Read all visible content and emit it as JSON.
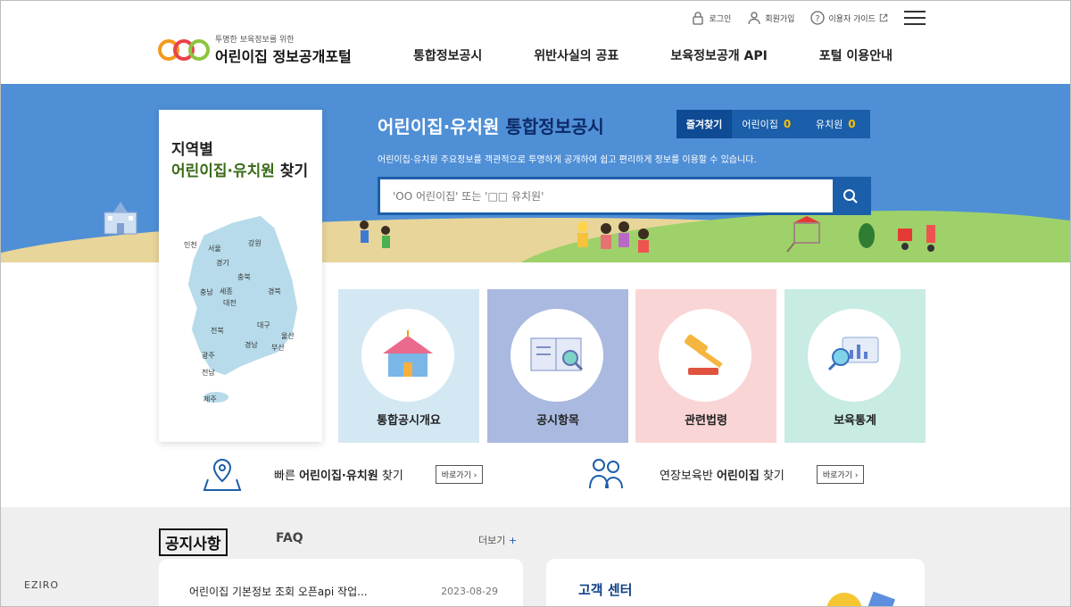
{
  "util": {
    "login": "로그인",
    "signup": "회원가입",
    "guide": "이용자 가이드"
  },
  "logo": {
    "sub": "투명한 보육정보를 위한",
    "main": "어린이집 정보공개포털"
  },
  "gnb": [
    "통합정보공시",
    "위반사실의 공표",
    "보육정보공개 API",
    "포털 이용안내"
  ],
  "hero": {
    "title_a": "어린이집·유치원",
    "title_b": "통합정보공시",
    "desc": "어린이집·유치원 주요정보를 객관적으로 투명하게 공개하여 쉽고 편리하게 정보를 이용할 수 있습니다.",
    "search_placeholder": "'OO 어린이집' 또는 '□□ 유치원'",
    "fav_label": "즐겨찾기",
    "fav_daycare": "어린이집",
    "fav_daycare_count": "0",
    "fav_kinder": "유치원",
    "fav_kinder_count": "0"
  },
  "region": {
    "line1": "지역별",
    "line2_green": "어린이집·유치원",
    "line2_rest": " 찾기",
    "labels": [
      "인천",
      "서울",
      "강원",
      "경기",
      "충북",
      "충남",
      "세종",
      "대전",
      "경북",
      "대구",
      "전북",
      "울산",
      "경남",
      "부산",
      "광주",
      "전남",
      "제주"
    ]
  },
  "tiles": [
    {
      "label": "통합공시개요",
      "bg": "#d4e8f4"
    },
    {
      "label": "공시항목",
      "bg": "#a9b9df"
    },
    {
      "label": "관련법령",
      "bg": "#fad5d5"
    },
    {
      "label": "보육통계",
      "bg": "#c8ebe3"
    }
  ],
  "quick": {
    "fast_a": "빠른 ",
    "fast_b": "어린이집·유치원",
    "fast_c": " 찾기",
    "ext_a": "연장보육반 ",
    "ext_b": "어린이집",
    "ext_c": " 찾기",
    "go": "바로가기"
  },
  "board": {
    "tab_notice": "공지사항",
    "tab_faq": "FAQ",
    "more": "더보기",
    "notice_title": "어린이집 기본정보 조회 오픈api 작업...",
    "notice_date": "2023-08-29",
    "cs_title": "고객 센터"
  },
  "watermark": "EZIRO"
}
